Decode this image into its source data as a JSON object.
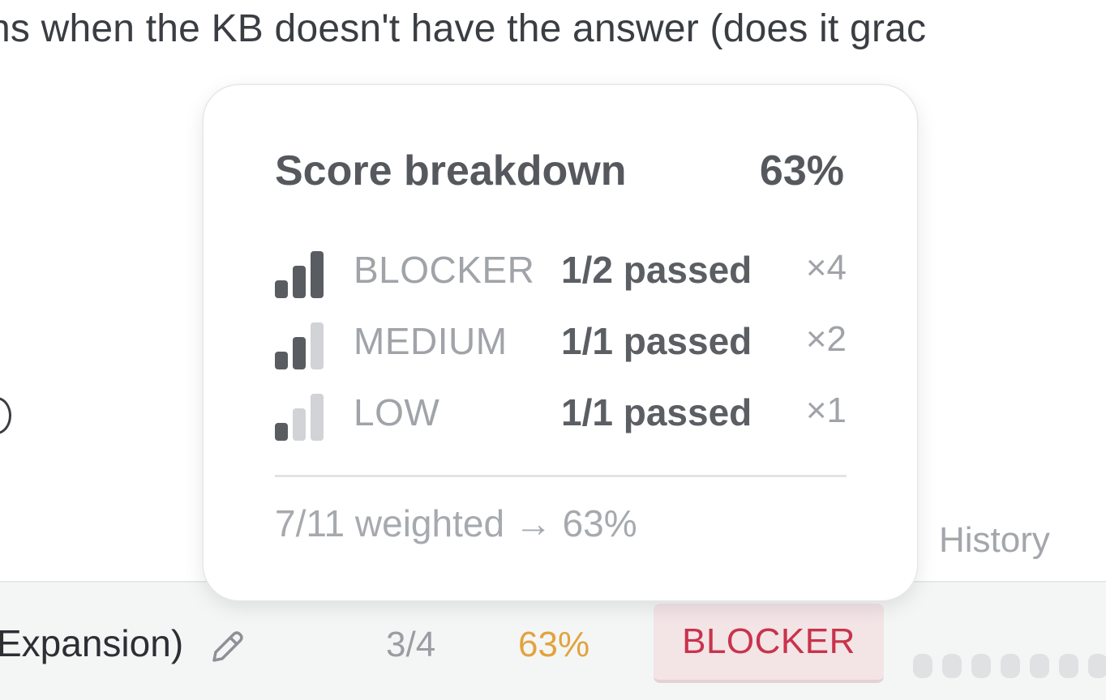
{
  "background": {
    "line_text": "ns when the KB doesn't have the answer (does it grac",
    "history_label": "History"
  },
  "row": {
    "title": "Expansion)",
    "count": "3/4",
    "score": "63%",
    "severity_badge": "BLOCKER",
    "history_dots": 7
  },
  "popover": {
    "title": "Score breakdown",
    "total": "63%",
    "severities": [
      {
        "label": "BLOCKER",
        "passed": "1/2 passed",
        "weight": "×4",
        "level": 3
      },
      {
        "label": "MEDIUM",
        "passed": "1/1 passed",
        "weight": "×2",
        "level": 2
      },
      {
        "label": "LOW",
        "passed": "1/1 passed",
        "weight": "×1",
        "level": 1
      }
    ],
    "footer": "7/11 weighted → 63%"
  },
  "colors": {
    "score_orange": "#e3a33d",
    "blocker_red": "#c8334c",
    "blocker_bg": "#f3e4e6"
  },
  "icons": {
    "edit": "pencil-icon",
    "severity": "signal-bars-icon"
  }
}
